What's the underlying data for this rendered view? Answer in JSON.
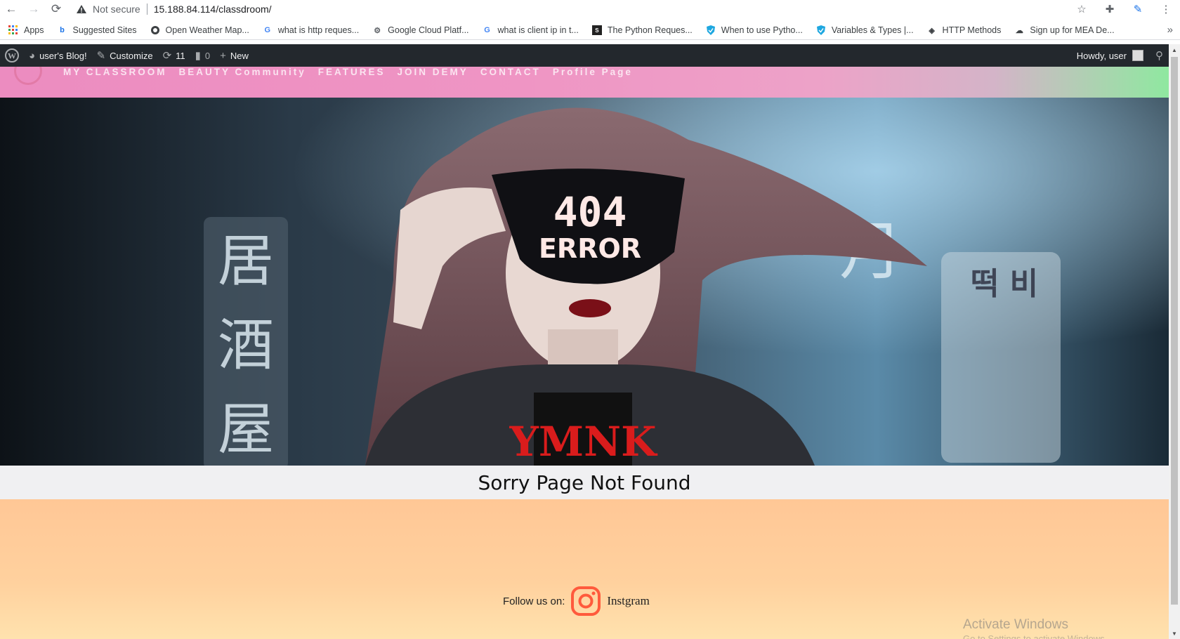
{
  "browser": {
    "security_label": "Not secure",
    "url": "15.188.84.114/classdroom/",
    "bookmarks": [
      {
        "label": "Apps",
        "icon": "apps-grid-icon"
      },
      {
        "label": "Suggested Sites",
        "icon": "bing-icon"
      },
      {
        "label": "Open Weather Map...",
        "icon": "openweather-icon"
      },
      {
        "label": "what is http reques...",
        "icon": "google-icon"
      },
      {
        "label": "Google Cloud Platf...",
        "icon": "gcp-icon"
      },
      {
        "label": "what is client ip in t...",
        "icon": "google-icon"
      },
      {
        "label": "The Python Reques...",
        "icon": "python-requests-icon"
      },
      {
        "label": "When to use Pytho...",
        "icon": "shield-icon"
      },
      {
        "label": "Variables & Types |...",
        "icon": "shield-icon"
      },
      {
        "label": "HTTP Methods",
        "icon": "diamond-icon"
      },
      {
        "label": "Sign up for MEA De...",
        "icon": "cloud-icon"
      }
    ]
  },
  "wp_admin_bar": {
    "site_name": "user's Blog!",
    "customize": "Customize",
    "updates_count": "11",
    "comments_count": "0",
    "new_label": "New",
    "howdy": "Howdy, user"
  },
  "site": {
    "menu": [
      "MY CLASSROOM",
      "BEAUTY Community",
      "FEATURES",
      "JOIN DEMY",
      "CONTACT",
      "Profile Page"
    ],
    "hero_text_line1": "404",
    "hero_text_line2": "ERROR",
    "notfound_text": "Sorry Page Not Found",
    "follow_label": "Follow us on:",
    "instagram_label": "Instgram"
  },
  "os_overlay": {
    "activate_title": "Activate Windows",
    "activate_sub": "Go to Settings to activate Windows."
  }
}
